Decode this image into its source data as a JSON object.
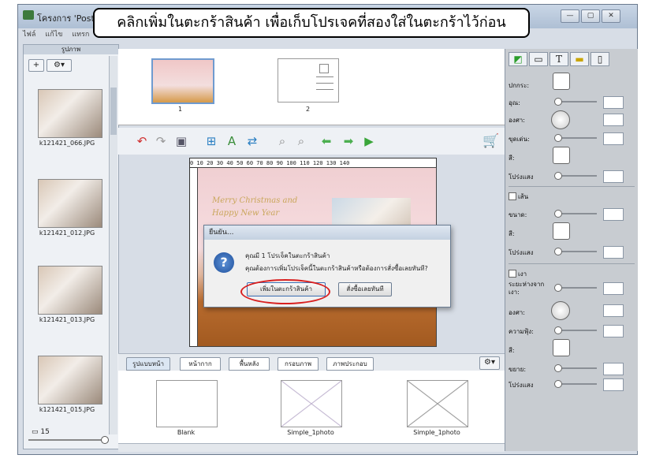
{
  "window": {
    "title": "โครงการ 'Postcard-",
    "menu": [
      "ไฟล์",
      "แก้ไข",
      "แทรก"
    ],
    "controls": [
      "—",
      "▢",
      "✕"
    ]
  },
  "callout": {
    "text": "คลิกเพิ่มในตะกร้าสินค้า เพื่อเก็บโปรเจคที่สองใส่ในตะกร้าไว้ก่อน"
  },
  "left_panel": {
    "header": "รูปภาพ",
    "add_label": "+",
    "options_label": "⚙▾",
    "photos": [
      {
        "caption": "k121421_066.JPG"
      },
      {
        "caption": "k121421_012.JPG"
      },
      {
        "caption": "k121421_013.JPG"
      },
      {
        "caption": "k121421_015.JPG"
      }
    ],
    "count": "15"
  },
  "pages": [
    {
      "number": "1"
    },
    {
      "number": "2"
    }
  ],
  "toolbar": {
    "icons": [
      "undo-icon",
      "redo-icon",
      "save-icon",
      "add-image-icon",
      "add-text-icon",
      "replace-image-icon",
      "zoom-in-icon",
      "zoom-out-icon",
      "prev-arrow-icon",
      "next-arrow-icon",
      "play-icon",
      "cart-icon"
    ]
  },
  "ruler": {
    "text": "0   10  20  30  40  50  60  70  80  90  100 110 120 130 140"
  },
  "canvas": {
    "greeting_line1": "Merry Christmas and",
    "greeting_line2": "Happy New Year"
  },
  "dialog": {
    "title": "ยืนยัน...",
    "message1": "คุณมี 1 โปรเจ็คในตะกร้าสินค้า",
    "message2": "คุณต้องการเพิ่มโปรเจ็คนี้ในตะกร้าสินค้าหรือต้องการสั่งซื้อเลยทันที?",
    "add_button": "เพิ่มในตะกร้าสินค้า",
    "order_button": "สั่งซื้อเลยทันที"
  },
  "bottom_tabs": [
    "รูปแบบหน้า",
    "หน้ากาก",
    "พื้นหลัง",
    "กรอบภาพ",
    "ภาพประกอบ"
  ],
  "templates": [
    {
      "caption": "Blank"
    },
    {
      "caption": "Simple_1photo"
    },
    {
      "caption": "Simple_1photo"
    }
  ],
  "right_panel": {
    "props": {
      "color": "ปกกระ:",
      "alpha": "อุณ:",
      "angle": "องศา:",
      "brush": "ขุดเด่น:",
      "fill": "สี:",
      "opacity1": "โปร่งแสง",
      "line_check": "เส้น",
      "size": "ขนาด:",
      "line_color": "สี:",
      "opacity2": "โปร่งแสง",
      "shadow_check": "เงา",
      "distance": "ระยะห่างจากเงา:",
      "shadow_angle": "องศา:",
      "softness": "ความฟุ้ง:",
      "shadow_color": "สี:",
      "spread": "ขยาย:",
      "opacity3": "โปร่งแสง"
    }
  },
  "colors": {
    "callout_border": "#000000",
    "highlight_ring": "#d82020",
    "dialog_icon": "#1e4f9b"
  }
}
